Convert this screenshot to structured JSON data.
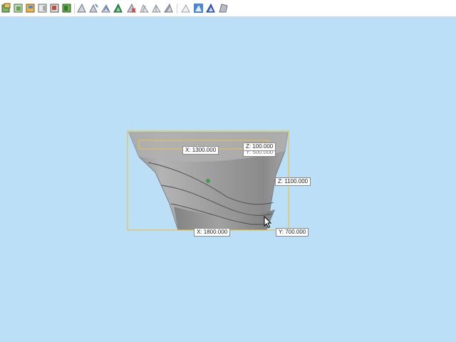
{
  "toolbar": {
    "buttons": [
      {
        "name": "view-iso-icon"
      },
      {
        "name": "view-front-icon"
      },
      {
        "name": "view-top-icon"
      },
      {
        "name": "view-right-icon"
      },
      {
        "name": "view-back-icon"
      },
      {
        "name": "view-left-icon"
      },
      {
        "name": "push-pull-icon"
      },
      {
        "name": "follow-me-icon"
      },
      {
        "name": "offset-icon"
      },
      {
        "name": "intersect-icon"
      },
      {
        "name": "subtract-icon"
      },
      {
        "name": "trim-icon"
      },
      {
        "name": "split-icon"
      },
      {
        "name": "union-icon"
      },
      {
        "name": "outer-shell-icon"
      },
      {
        "name": "sandbox-contours-icon"
      },
      {
        "name": "sandbox-scratch-icon"
      },
      {
        "name": "smoove-icon"
      },
      {
        "name": "stamp-icon"
      }
    ]
  },
  "colors": {
    "background": "#bcdff8",
    "bounding_box": "#e8c34a",
    "model": "#9a9a9a",
    "center_point": "#2cbf3a"
  },
  "dimensions": {
    "z_label": "Z: 100.000",
    "z_hidden_label": "Y: 500.000",
    "x_top_label": "X: 1300.000",
    "z_right_label": "Z: 1100.000",
    "x_bottom_label": "X: 1800.000",
    "y_label": "Y: 700.000"
  }
}
